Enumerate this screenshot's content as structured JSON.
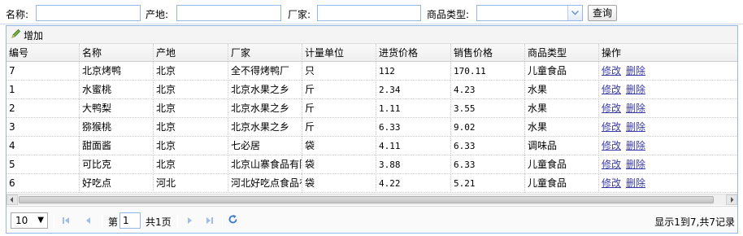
{
  "search": {
    "name_label": "名称:",
    "origin_label": "产地:",
    "maker_label": "厂家:",
    "category_label": "商品类型:",
    "query_button": "查询",
    "name_value": "",
    "origin_value": "",
    "maker_value": "",
    "category_value": ""
  },
  "toolbar": {
    "add_label": "增加",
    "add_icon": "pencil-icon"
  },
  "table": {
    "columns": [
      "编号",
      "名称",
      "产地",
      "厂家",
      "计量单位",
      "进货价格",
      "销售价格",
      "商品类型",
      "操作"
    ],
    "edit_label": "修改",
    "delete_label": "删除",
    "rows": [
      [
        "7",
        "北京烤鸭",
        "北京",
        "全不得烤鸭厂",
        "只",
        "112",
        "170.11",
        "儿童食品"
      ],
      [
        "1",
        "水蜜桃",
        "北京",
        "北京水果之乡",
        "斤",
        "2.34",
        "4.23",
        "水果"
      ],
      [
        "2",
        "大鸭梨",
        "北京",
        "北京水果之乡",
        "斤",
        "1.11",
        "3.55",
        "水果"
      ],
      [
        "3",
        "猕猴桃",
        "北京",
        "北京水果之乡",
        "斤",
        "6.33",
        "9.02",
        "水果"
      ],
      [
        "4",
        "甜面酱",
        "北京",
        "七必居",
        "袋",
        "4.11",
        "6.33",
        "调味品"
      ],
      [
        "5",
        "可比克",
        "北京",
        "北京山寨食品有限",
        "袋",
        "3.88",
        "6.33",
        "儿童食品"
      ],
      [
        "6",
        "好吃点",
        "河北",
        "河北好吃点食品有限",
        "袋",
        "4.22",
        "5.21",
        "儿童食品"
      ]
    ]
  },
  "pager": {
    "page_size": "10",
    "page_prefix": "第",
    "page_value": "1",
    "page_suffix": "共1页",
    "info": "显示1到7,共7记录"
  },
  "colors": {
    "border": "#95b8e7",
    "link": "#3a3aa8"
  }
}
